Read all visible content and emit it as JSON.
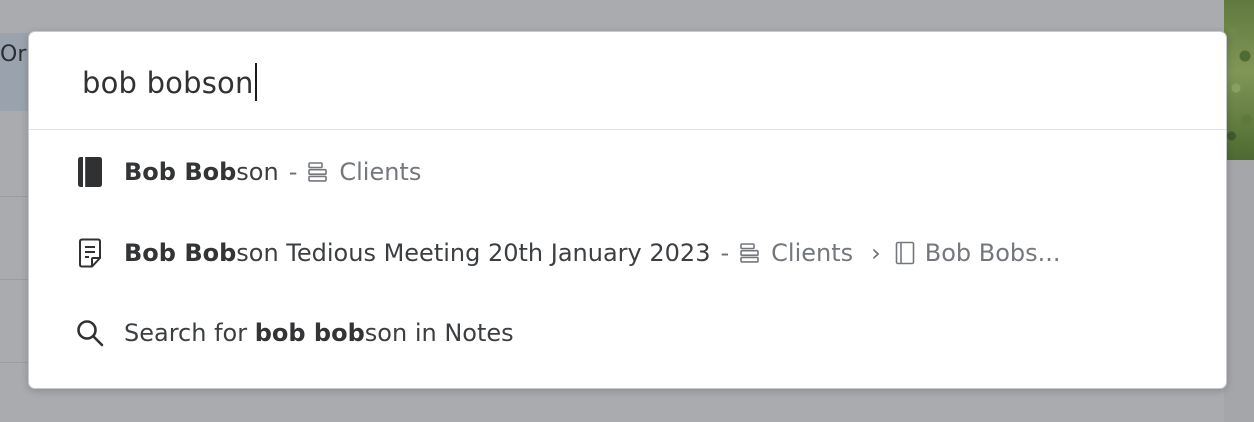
{
  "background": {
    "header_fragment": "Or"
  },
  "search": {
    "query": "bob bobson"
  },
  "results": [
    {
      "icon": "notebook-icon",
      "title_bold": "Bob Bob",
      "title_rest": "son",
      "separator": "-",
      "location_icon": "stack-icon",
      "location": "Clients"
    },
    {
      "icon": "note-icon",
      "title_bold": "Bob Bob",
      "title_rest": "son Tedious Meeting 20th January 2023",
      "separator": "-",
      "location_icon": "stack-icon",
      "location": "Clients",
      "chevron": "›",
      "sub_icon": "notebook-outline-icon",
      "sub_location": "Bob Bobs..."
    },
    {
      "icon": "search-icon",
      "prefix": "Search for ",
      "query_bold": "bob bob",
      "query_rest": "son",
      "suffix": " in Notes"
    }
  ]
}
